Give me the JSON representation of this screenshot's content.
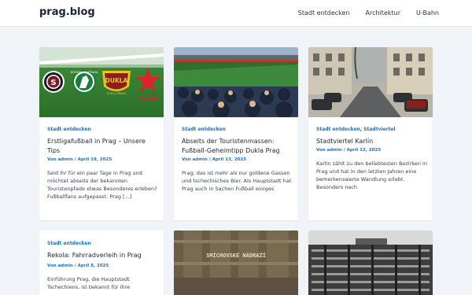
{
  "site": {
    "title": "prag.blog"
  },
  "nav": {
    "items": [
      "Stadt entdecken",
      "Architektur",
      "U-Bahn"
    ]
  },
  "cards": [
    {
      "categories": [
        "Stadt entdecken"
      ],
      "title": "Erstligafußball in Prag – Unsere Tips",
      "meta": "Von admin / April 19, 2025",
      "excerpt": "Seid ihr für ein paar Tage in Prag und möchtet abseits der bekannten Touristenpfade etwas Besonderes erleben? Fußballfans aufgepasst: Prag [...]",
      "logo_labels": [
        "S",
        "BOHEMIANS PRAHA",
        "DUKLA PRAHA",
        "SLAVIA"
      ]
    },
    {
      "categories": [
        "Stadt entdecken"
      ],
      "title": "Abseits der Touristenmassen: Fußball-Geheimtipp Dukla Prag",
      "meta": "Von admin / April 13, 2025",
      "excerpt": "Prag, das ist mehr als nur goldene Gassen und tschechisches Bier. Als Hauptstadt hat Prag auch in Sachen Fußball einiges"
    },
    {
      "categories": [
        "Stadt entdecken",
        "Stadtviertel"
      ],
      "title": "Stadtviertel Karlín",
      "meta": "Von admin / April 12, 2025",
      "excerpt": "Karlín zählt zu den beliebtesten Bezirken in Prag und hat in den letzten Jahren eine bemerkenswerte Wandlung erlebt. Besonders nach"
    },
    {
      "categories": [
        "Stadt entdecken"
      ],
      "title": "Rekola: Fahrradverleih in Prag",
      "meta": "Von admin / April 8, 2025",
      "excerpt": "Einführung Prag, die Hauptstadt Tschechiens, ist bekannt für ihre"
    },
    {
      "sign_text": "SMÍCHOVSKÉ NÁDRAŽÍ"
    },
    {}
  ],
  "colors": {
    "link": "#1e73be",
    "background": "#f0f4f8"
  }
}
